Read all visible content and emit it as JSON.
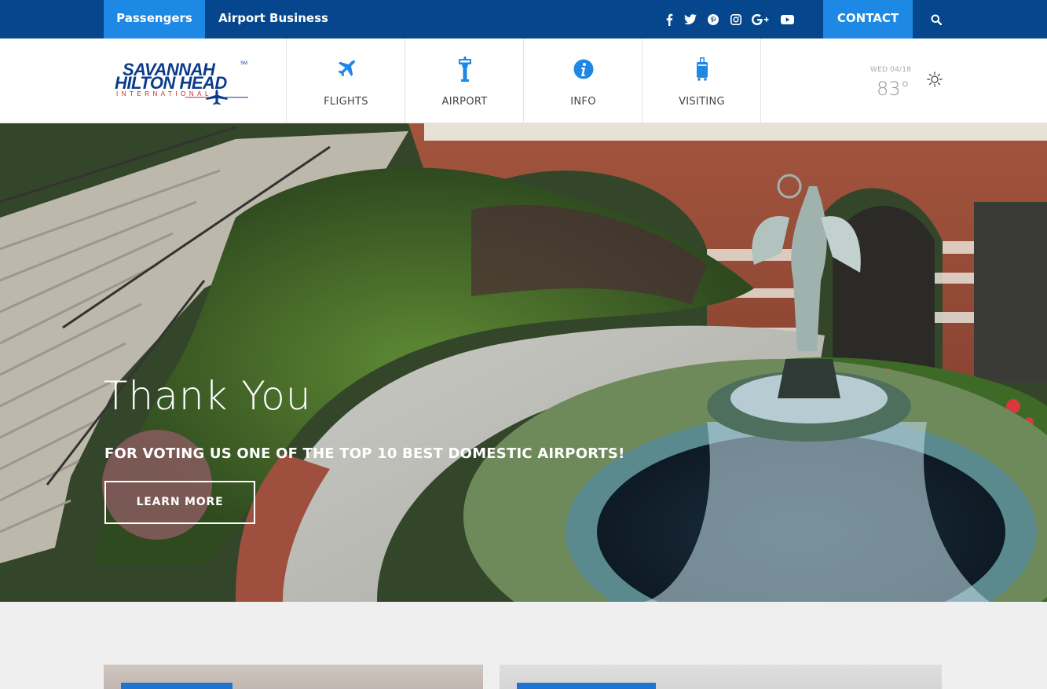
{
  "topbar": {
    "tabs": [
      {
        "label": "Passengers",
        "active": true
      },
      {
        "label": "Airport Business",
        "active": false
      }
    ],
    "social": [
      "facebook-icon",
      "twitter-icon",
      "pinterest-icon",
      "instagram-icon",
      "google-plus-icon",
      "youtube-icon"
    ],
    "contact_label": "CONTACT",
    "search_icon": "search-icon"
  },
  "logo": {
    "line1": "SAVANNAH",
    "mark": "SM",
    "line2": "HILTON HEAD",
    "line3": "INTERNATIONAL"
  },
  "nav": [
    {
      "label": "FLIGHTS",
      "icon": "airplane-icon"
    },
    {
      "label": "AIRPORT",
      "icon": "control-tower-icon"
    },
    {
      "label": "INFO",
      "icon": "info-icon"
    },
    {
      "label": "VISITING",
      "icon": "luggage-icon"
    }
  ],
  "weather": {
    "date": "WED 04/18",
    "temp": "83°",
    "icon": "sun-icon"
  },
  "hero": {
    "title": "Thank You",
    "subtitle": "FOR VOTING US ONE OF THE TOP 10 BEST DOMESTIC AIRPORTS!",
    "button": "LEARN MORE"
  },
  "colors": {
    "topbar": "#05468c",
    "accent": "#1e88e5",
    "logo_blue": "#0a3b8c",
    "logo_red": "#c4262e"
  }
}
